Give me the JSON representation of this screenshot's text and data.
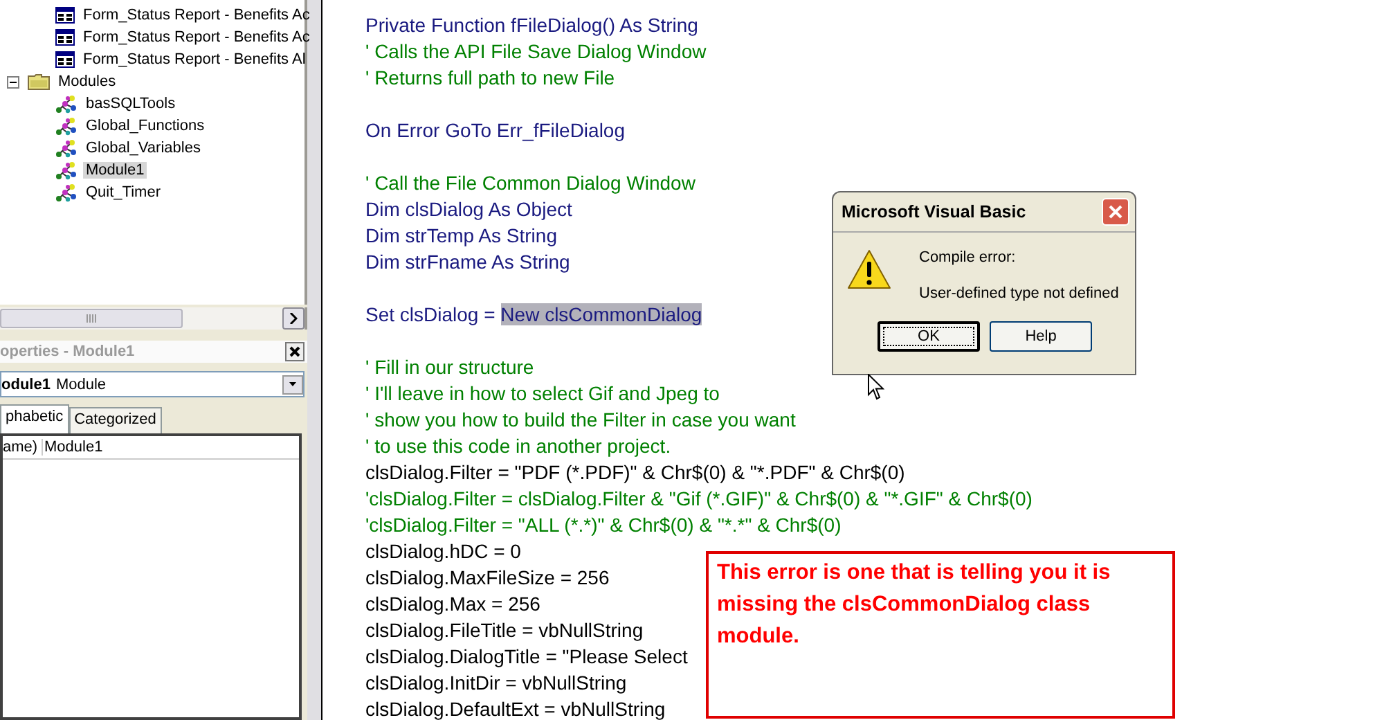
{
  "project_tree": {
    "partial_items": [
      {
        "label": "Form_Status Report - Benefits Ac",
        "kind": "form"
      },
      {
        "label": "Form_Status Report - Benefits Ac",
        "kind": "form"
      },
      {
        "label": "Form_Status Report - Benefits Al",
        "kind": "form"
      }
    ],
    "folders": [
      {
        "label": "Modules",
        "expanded": true,
        "children": [
          {
            "label": "basSQLTools",
            "selected": false
          },
          {
            "label": "Global_Functions",
            "selected": false
          },
          {
            "label": "Global_Variables",
            "selected": false
          },
          {
            "label": "Module1",
            "selected": true
          },
          {
            "label": "Quit_Timer",
            "selected": false
          }
        ]
      }
    ]
  },
  "properties": {
    "title": "operties - Module1",
    "object_name": "odule1",
    "object_type": "Module",
    "tabs": [
      {
        "label": "phabetic",
        "selected": true
      },
      {
        "label": "Categorized",
        "selected": false
      }
    ],
    "rows": [
      {
        "name": "ame)",
        "value": "Module1"
      }
    ]
  },
  "code_lines": [
    {
      "kind": "statement",
      "text": "Private Function fFileDialog() As String"
    },
    {
      "kind": "comment",
      "text": "' Calls the API File Save Dialog Window"
    },
    {
      "kind": "comment",
      "text": "' Returns full path to new File"
    },
    {
      "kind": "blank"
    },
    {
      "kind": "statement",
      "text": "On Error GoTo Err_fFileDialog"
    },
    {
      "kind": "blank"
    },
    {
      "kind": "comment",
      "text": "' Call the File Common Dialog Window"
    },
    {
      "kind": "statement",
      "text": "Dim clsDialog As Object"
    },
    {
      "kind": "statement",
      "text": "Dim strTemp As String"
    },
    {
      "kind": "statement",
      "text": "Dim strFname As String"
    },
    {
      "kind": "blank"
    },
    {
      "kind": "statement",
      "text": "Set clsDialog =",
      "highlight": "New clsCommonDialog"
    },
    {
      "kind": "blank"
    },
    {
      "kind": "comment",
      "text": "' Fill in our structure"
    },
    {
      "kind": "comment",
      "text": "' I'll leave in how to select Gif and Jpeg to"
    },
    {
      "kind": "comment",
      "text": "' show you how to build the Filter in case you want"
    },
    {
      "kind": "comment",
      "text": "' to use this code in another project."
    },
    {
      "kind": "plain",
      "text": "clsDialog.Filter = \"PDF (*.PDF)\" & Chr$(0) & \"*.PDF\" & Chr$(0)"
    },
    {
      "kind": "comment",
      "text": "'clsDialog.Filter = clsDialog.Filter & \"Gif (*.GIF)\" & Chr$(0) & \"*.GIF\" & Chr$(0)"
    },
    {
      "kind": "comment",
      "text": "'clsDialog.Filter = \"ALL (*.*)\" & Chr$(0) & \"*.*\" & Chr$(0)"
    },
    {
      "kind": "plain",
      "text": "clsDialog.hDC = 0"
    },
    {
      "kind": "plain",
      "text": "clsDialog.MaxFileSize = 256"
    },
    {
      "kind": "plain",
      "text": "clsDialog.Max = 256"
    },
    {
      "kind": "plain",
      "text": "clsDialog.FileTitle = vbNullString"
    },
    {
      "kind": "plain",
      "text": "clsDialog.DialogTitle = \"Please Select"
    },
    {
      "kind": "plain",
      "text": "clsDialog.InitDir = vbNullString"
    },
    {
      "kind": "plain",
      "text": "clsDialog.DefaultExt = vbNullString"
    }
  ],
  "dialog": {
    "title": "Microsoft Visual Basic",
    "heading": "Compile error:",
    "message": "User-defined type not defined",
    "buttons": [
      {
        "label": "OK",
        "default": true
      },
      {
        "label": "Help",
        "default": false
      }
    ]
  },
  "annotation": {
    "text": "This error is one that is telling you it is missing the clsCommonDialog class module."
  }
}
